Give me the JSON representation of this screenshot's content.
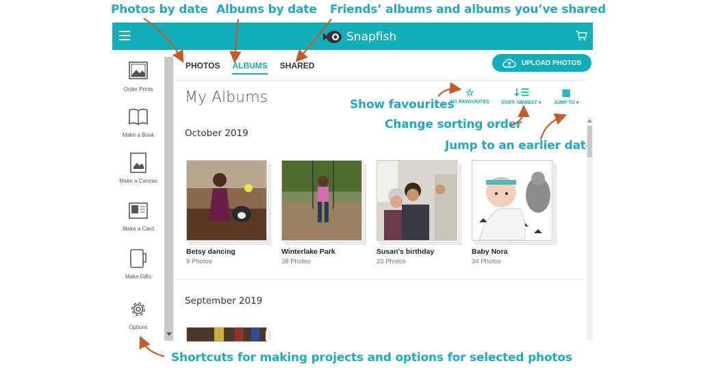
{
  "annotations": {
    "photos_by_date": "Photos by date",
    "albums_by_date": "Albums by date",
    "friends_shared": "Friends’ albums and albums you’ve shared",
    "show_favourites": "Show favourites",
    "change_sorting": "Change sorting order",
    "jump_earlier": "Jump to an earlier date",
    "shortcuts": "Shortcuts for making projects and options for selected photos"
  },
  "header": {
    "brand": "Snapfish",
    "color": "#12aeb9"
  },
  "sidebar": {
    "items": [
      {
        "label": "Order Prints",
        "icon": "prints-icon"
      },
      {
        "label": "Make a Book",
        "icon": "book-icon"
      },
      {
        "label": "Make a Canvas",
        "icon": "canvas-icon"
      },
      {
        "label": "Make a Card",
        "icon": "card-icon"
      },
      {
        "label": "Make Gifts",
        "icon": "mug-icon"
      },
      {
        "label": "Options",
        "icon": "gear-icon"
      }
    ]
  },
  "tabs": [
    {
      "label": "PHOTOS",
      "active": false
    },
    {
      "label": "ALBUMS",
      "active": true
    },
    {
      "label": "SHARED",
      "active": false
    }
  ],
  "upload_label": "UPLOAD PHOTOS",
  "page_title": "My Albums",
  "tools": {
    "favourites": "MY FAVOURITES",
    "sort": "SORT: NEWEST ▾",
    "jump": "JUMP TO ▾"
  },
  "sections": [
    {
      "title": "October 2019",
      "albums": [
        {
          "name": "Betsy dancing",
          "count": "9 Photos"
        },
        {
          "name": "Winterlake Park",
          "count": "38 Photos"
        },
        {
          "name": "Susan's birthday",
          "count": "23 Photos"
        },
        {
          "name": "Baby Nora",
          "count": "34 Photos"
        }
      ]
    },
    {
      "title": "September 2019",
      "albums": []
    }
  ]
}
